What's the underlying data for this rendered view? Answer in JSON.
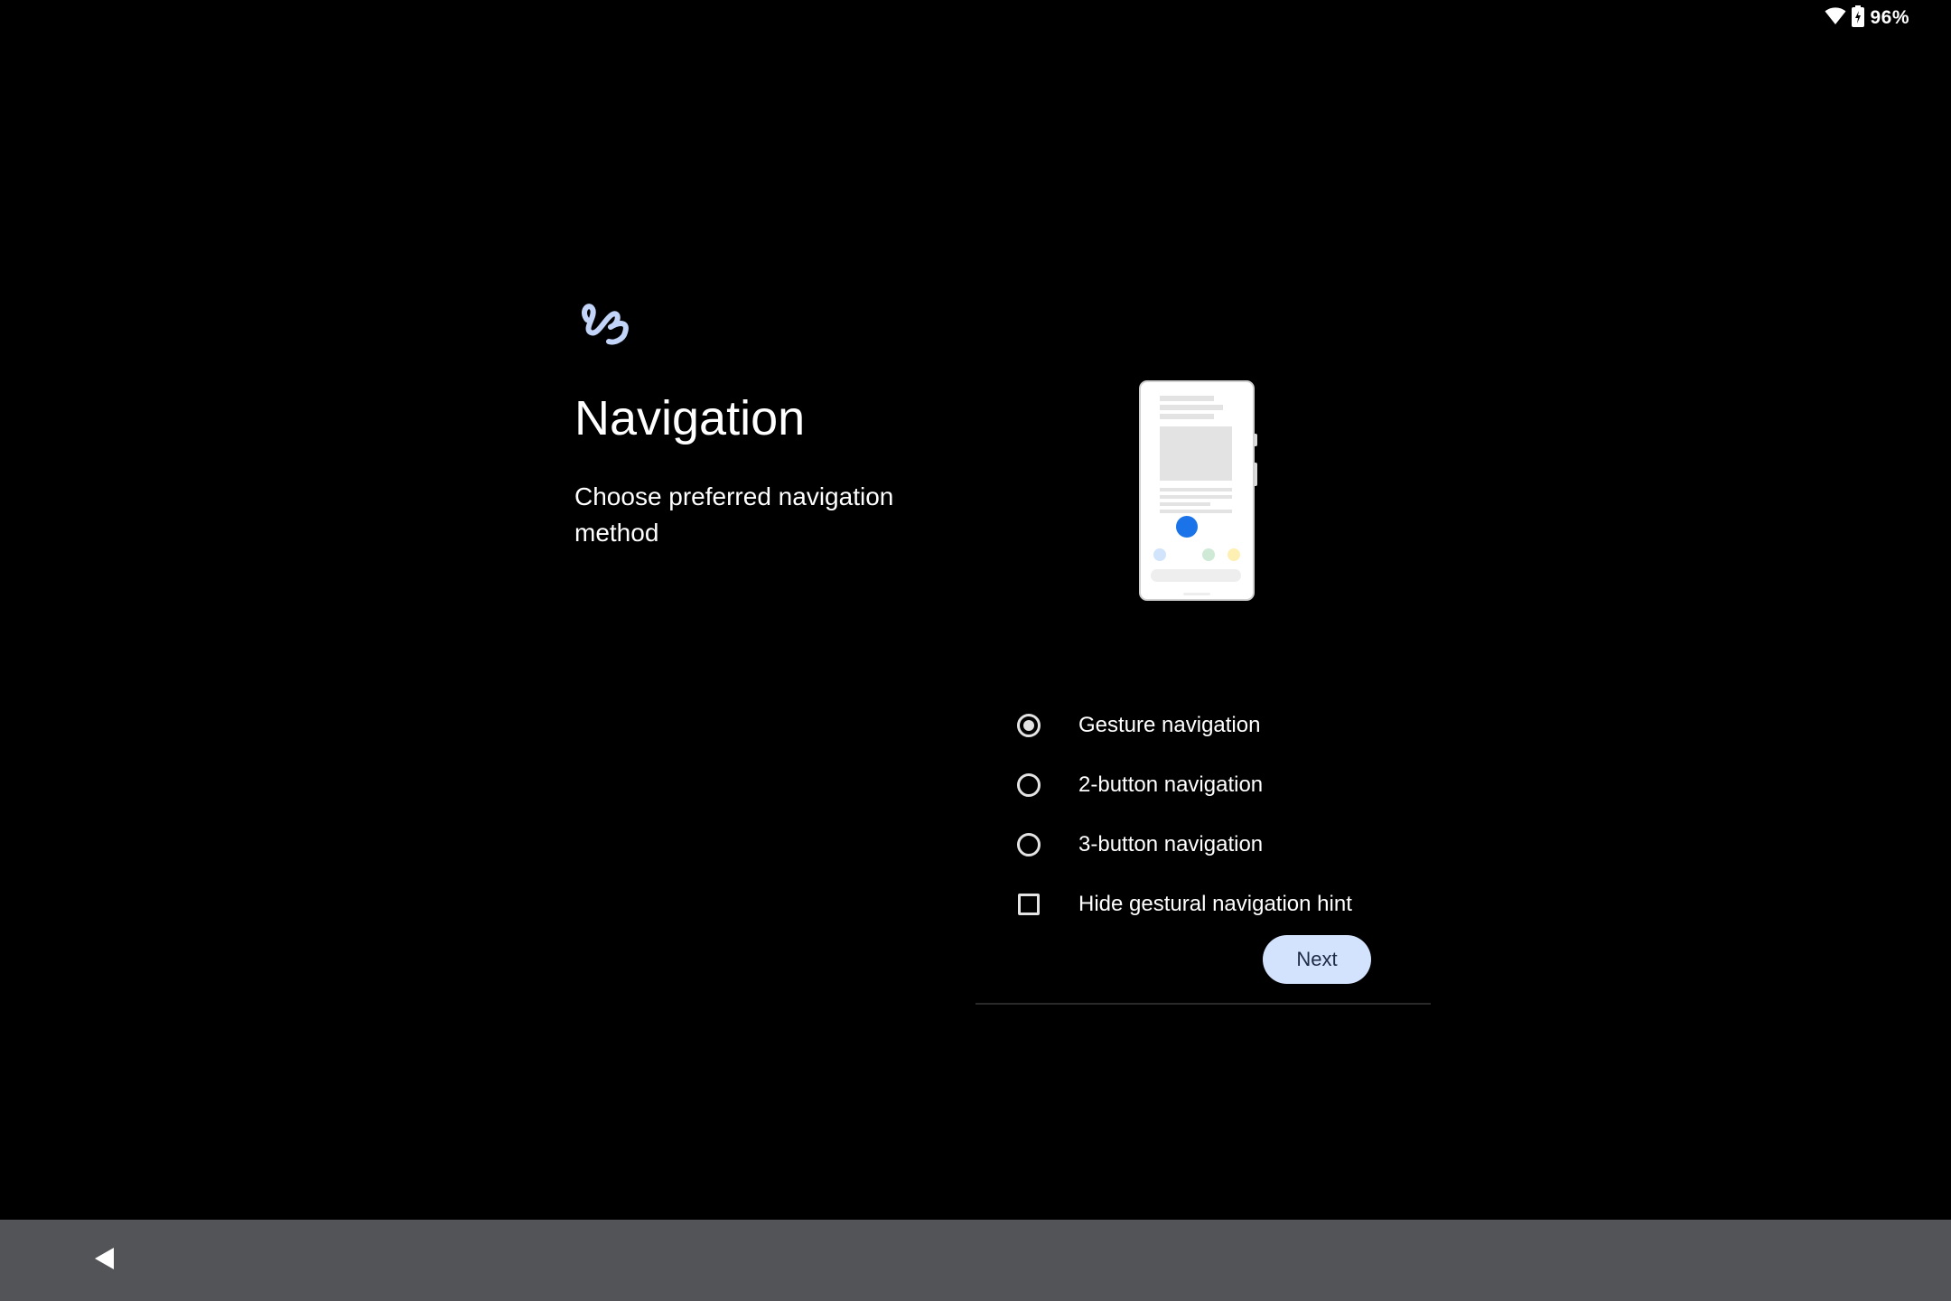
{
  "status_bar": {
    "battery_percent": "96%",
    "icons": [
      "wifi-icon",
      "battery-icon"
    ]
  },
  "header": {
    "icon": "squiggle-gesture-icon",
    "title": "Navigation",
    "subtitle": "Choose preferred navigation method"
  },
  "illustration": {
    "description_icon": "phone-illustration"
  },
  "options": [
    {
      "label": "Gesture navigation",
      "type": "radio",
      "checked": true
    },
    {
      "label": "2-button navigation",
      "type": "radio",
      "checked": false
    },
    {
      "label": "3-button navigation",
      "type": "radio",
      "checked": false
    },
    {
      "label": "Hide gestural navigation hint",
      "type": "checkbox",
      "checked": false
    }
  ],
  "actions": {
    "next_label": "Next"
  },
  "nav_bar": {
    "back_icon": "back-triangle-icon"
  },
  "colors": {
    "background": "#000000",
    "accent": "#d3e3fd",
    "icon_accent": "#c2d4f7",
    "nav_bar": "#535458",
    "illustration_dot": "#1a73e8"
  }
}
